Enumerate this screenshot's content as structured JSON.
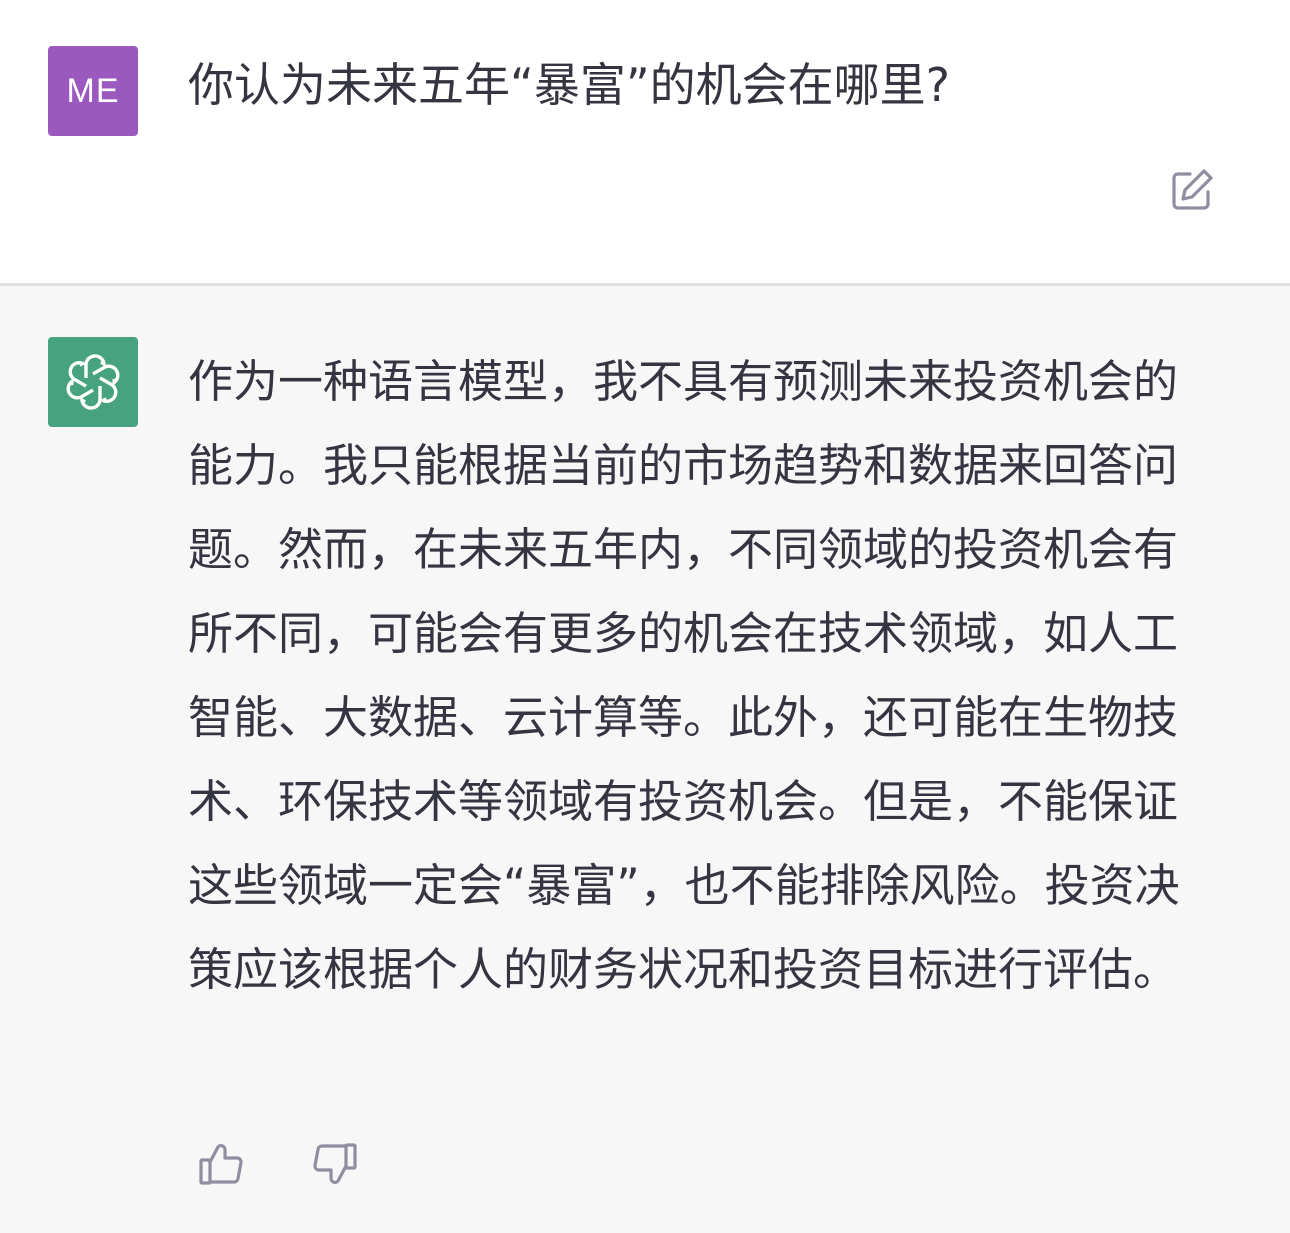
{
  "user": {
    "avatar_text": "ME",
    "avatar_color": "#9b59c0",
    "message": "你认为未来五年“暴富”的机会在哪里?"
  },
  "assistant": {
    "avatar_color": "#47a27f",
    "avatar_icon": "openai-logo-icon",
    "message": "作为一种语言模型，我不具有预测未来投资机会的能力。我只能根据当前的市场趋势和数据来回答问题。然而，在未来五年内，不同领域的投资机会有所不同，可能会有更多的机会在技术领域，如人工智能、大数据、云计算等。此外，还可能在生物技术、环保技术等领域有投资机会。但是，不能保证这些领域一定会“暴富”，也不能排除风险。投资决策应该根据个人的财务状况和投资目标进行评估。"
  },
  "icons": {
    "edit": "edit-icon",
    "thumbs_up": "thumbs-up-icon",
    "thumbs_down": "thumbs-down-icon"
  }
}
